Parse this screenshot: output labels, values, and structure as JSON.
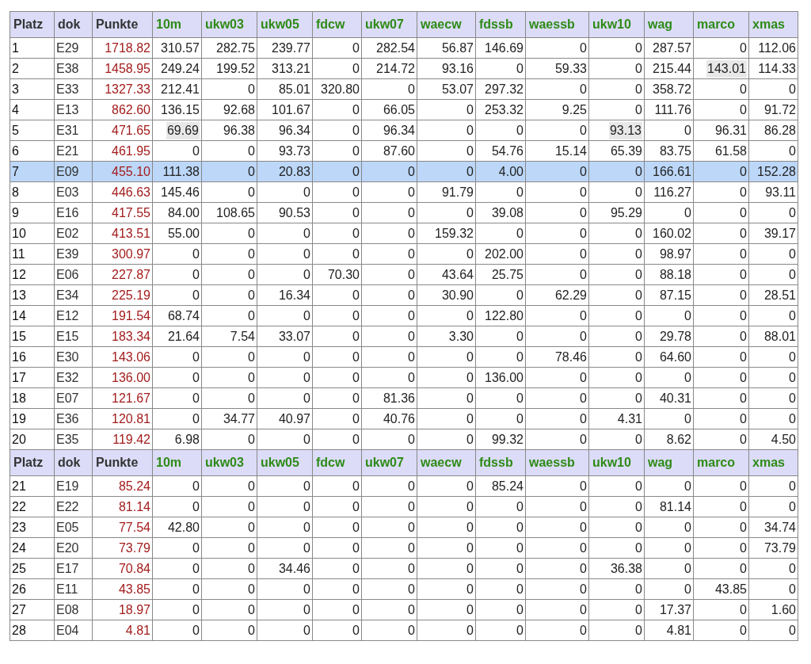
{
  "sections": [
    {
      "columns": [
        {
          "label": "Platz",
          "kind": "rank"
        },
        {
          "label": "dok",
          "kind": "team"
        },
        {
          "label": "Punkte",
          "kind": "total"
        },
        {
          "label": "10m",
          "kind": "score"
        },
        {
          "label": "ukw03",
          "kind": "score"
        },
        {
          "label": "ukw05",
          "kind": "score"
        },
        {
          "label": "fdcw",
          "kind": "score"
        },
        {
          "label": "ukw07",
          "kind": "score"
        },
        {
          "label": "waecw",
          "kind": "score"
        },
        {
          "label": "fdssb",
          "kind": "score"
        },
        {
          "label": "waessb",
          "kind": "score"
        },
        {
          "label": "ukw10",
          "kind": "score"
        },
        {
          "label": "wag",
          "kind": "score"
        },
        {
          "label": "marco",
          "kind": "score"
        },
        {
          "label": "xmas",
          "kind": "score"
        }
      ],
      "rows": [
        {
          "selected": false,
          "cells": [
            "1",
            "E29",
            "1718.82",
            "310.57",
            "282.75",
            "239.77",
            "0",
            "282.54",
            "56.87",
            "146.69",
            "0",
            "0",
            "287.57",
            "0",
            "112.06"
          ]
        },
        {
          "selected": false,
          "cells": [
            "2",
            "E38",
            "1458.95",
            "249.24",
            "199.52",
            "313.21",
            "0",
            "214.72",
            "93.16",
            "0",
            "59.33",
            "0",
            "215.44",
            {
              "value": "143.01",
              "marked": true
            },
            "114.33"
          ]
        },
        {
          "selected": false,
          "cells": [
            "3",
            "E33",
            "1327.33",
            "212.41",
            "0",
            "85.01",
            "320.80",
            "0",
            "53.07",
            "297.32",
            "0",
            "0",
            "358.72",
            "0",
            "0"
          ]
        },
        {
          "selected": false,
          "cells": [
            "4",
            "E13",
            "862.60",
            "136.15",
            "92.68",
            "101.67",
            "0",
            "66.05",
            "0",
            "253.32",
            "9.25",
            "0",
            "111.76",
            "0",
            "91.72"
          ]
        },
        {
          "selected": false,
          "cells": [
            "5",
            "E31",
            "471.65",
            {
              "value": "69.69",
              "marked": true
            },
            "96.38",
            "96.34",
            "0",
            "96.34",
            "0",
            "0",
            "0",
            {
              "value": "93.13",
              "marked": true
            },
            "0",
            "96.31",
            "86.28"
          ]
        },
        {
          "selected": false,
          "cells": [
            "6",
            "E21",
            "461.95",
            "0",
            "0",
            "93.73",
            "0",
            "87.60",
            "0",
            "54.76",
            "15.14",
            "65.39",
            "83.75",
            "61.58",
            "0"
          ]
        },
        {
          "selected": true,
          "cells": [
            "7",
            "E09",
            "455.10",
            "111.38",
            "0",
            "20.83",
            "0",
            "0",
            "0",
            "4.00",
            "0",
            "0",
            "166.61",
            "0",
            "152.28"
          ]
        },
        {
          "selected": false,
          "cells": [
            "8",
            "E03",
            "446.63",
            "145.46",
            "0",
            "0",
            "0",
            "0",
            "91.79",
            "0",
            "0",
            "0",
            "116.27",
            "0",
            "93.11"
          ]
        },
        {
          "selected": false,
          "cells": [
            "9",
            "E16",
            "417.55",
            "84.00",
            "108.65",
            "90.53",
            "0",
            "0",
            "0",
            "39.08",
            "0",
            "95.29",
            "0",
            "0",
            "0"
          ]
        },
        {
          "selected": false,
          "cells": [
            "10",
            "E02",
            "413.51",
            "55.00",
            "0",
            "0",
            "0",
            "0",
            "159.32",
            "0",
            "0",
            "0",
            "160.02",
            "0",
            "39.17"
          ]
        },
        {
          "selected": false,
          "cells": [
            "11",
            "E39",
            "300.97",
            "0",
            "0",
            "0",
            "0",
            "0",
            "0",
            "202.00",
            "0",
            "0",
            "98.97",
            "0",
            "0"
          ]
        },
        {
          "selected": false,
          "cells": [
            "12",
            "E06",
            "227.87",
            "0",
            "0",
            "0",
            "70.30",
            "0",
            "43.64",
            "25.75",
            "0",
            "0",
            "88.18",
            "0",
            "0"
          ]
        },
        {
          "selected": false,
          "cells": [
            "13",
            "E34",
            "225.19",
            "0",
            "0",
            "16.34",
            "0",
            "0",
            "30.90",
            "0",
            "62.29",
            "0",
            "87.15",
            "0",
            "28.51"
          ]
        },
        {
          "selected": false,
          "cells": [
            "14",
            "E12",
            "191.54",
            "68.74",
            "0",
            "0",
            "0",
            "0",
            "0",
            "122.80",
            "0",
            "0",
            "0",
            "0",
            "0"
          ]
        },
        {
          "selected": false,
          "cells": [
            "15",
            "E15",
            "183.34",
            "21.64",
            "7.54",
            "33.07",
            "0",
            "0",
            "3.30",
            "0",
            "0",
            "0",
            "29.78",
            "0",
            "88.01"
          ]
        },
        {
          "selected": false,
          "cells": [
            "16",
            "E30",
            "143.06",
            "0",
            "0",
            "0",
            "0",
            "0",
            "0",
            "0",
            "78.46",
            "0",
            "64.60",
            "0",
            "0"
          ]
        },
        {
          "selected": false,
          "cells": [
            "17",
            "E32",
            "136.00",
            "0",
            "0",
            "0",
            "0",
            "0",
            "0",
            "136.00",
            "0",
            "0",
            "0",
            "0",
            "0"
          ]
        },
        {
          "selected": false,
          "cells": [
            "18",
            "E07",
            "121.67",
            "0",
            "0",
            "0",
            "0",
            "81.36",
            "0",
            "0",
            "0",
            "0",
            "40.31",
            "0",
            "0"
          ]
        },
        {
          "selected": false,
          "cells": [
            "19",
            "E36",
            "120.81",
            "0",
            "34.77",
            "40.97",
            "0",
            "40.76",
            "0",
            "0",
            "0",
            "4.31",
            "0",
            "0",
            "0"
          ]
        },
        {
          "selected": false,
          "cells": [
            "20",
            "E35",
            "119.42",
            "6.98",
            "0",
            "0",
            "0",
            "0",
            "0",
            "99.32",
            "0",
            "0",
            "8.62",
            "0",
            "4.50"
          ]
        }
      ]
    },
    {
      "columns": [
        {
          "label": "Platz",
          "kind": "rank"
        },
        {
          "label": "dok",
          "kind": "team"
        },
        {
          "label": "Punkte",
          "kind": "total"
        },
        {
          "label": "10m",
          "kind": "score"
        },
        {
          "label": "ukw03",
          "kind": "score"
        },
        {
          "label": "ukw05",
          "kind": "score"
        },
        {
          "label": "fdcw",
          "kind": "score"
        },
        {
          "label": "ukw07",
          "kind": "score"
        },
        {
          "label": "waecw",
          "kind": "score"
        },
        {
          "label": "fdssb",
          "kind": "score"
        },
        {
          "label": "waessb",
          "kind": "score"
        },
        {
          "label": "ukw10",
          "kind": "score"
        },
        {
          "label": "wag",
          "kind": "score"
        },
        {
          "label": "marco",
          "kind": "score"
        },
        {
          "label": "xmas",
          "kind": "score"
        }
      ],
      "rows": [
        {
          "selected": false,
          "cells": [
            "21",
            "E19",
            "85.24",
            "0",
            "0",
            "0",
            "0",
            "0",
            "0",
            "85.24",
            "0",
            "0",
            "0",
            "0",
            "0"
          ]
        },
        {
          "selected": false,
          "cells": [
            "22",
            "E22",
            "81.14",
            "0",
            "0",
            "0",
            "0",
            "0",
            "0",
            "0",
            "0",
            "0",
            "81.14",
            "0",
            "0"
          ]
        },
        {
          "selected": false,
          "cells": [
            "23",
            "E05",
            "77.54",
            "42.80",
            "0",
            "0",
            "0",
            "0",
            "0",
            "0",
            "0",
            "0",
            "0",
            "0",
            "34.74"
          ]
        },
        {
          "selected": false,
          "cells": [
            "24",
            "E20",
            "73.79",
            "0",
            "0",
            "0",
            "0",
            "0",
            "0",
            "0",
            "0",
            "0",
            "0",
            "0",
            "73.79"
          ]
        },
        {
          "selected": false,
          "cells": [
            "25",
            "E17",
            "70.84",
            "0",
            "0",
            "34.46",
            "0",
            "0",
            "0",
            "0",
            "0",
            "36.38",
            "0",
            "0",
            "0"
          ]
        },
        {
          "selected": false,
          "cells": [
            "26",
            "E11",
            "43.85",
            "0",
            "0",
            "0",
            "0",
            "0",
            "0",
            "0",
            "0",
            "0",
            "0",
            "43.85",
            "0"
          ]
        },
        {
          "selected": false,
          "cells": [
            "27",
            "E08",
            "18.97",
            "0",
            "0",
            "0",
            "0",
            "0",
            "0",
            "0",
            "0",
            "0",
            "17.37",
            "0",
            "1.60"
          ]
        },
        {
          "selected": false,
          "cells": [
            "28",
            "E04",
            "4.81",
            "0",
            "0",
            "0",
            "0",
            "0",
            "0",
            "0",
            "0",
            "0",
            "4.81",
            "0",
            "0"
          ]
        }
      ]
    }
  ]
}
